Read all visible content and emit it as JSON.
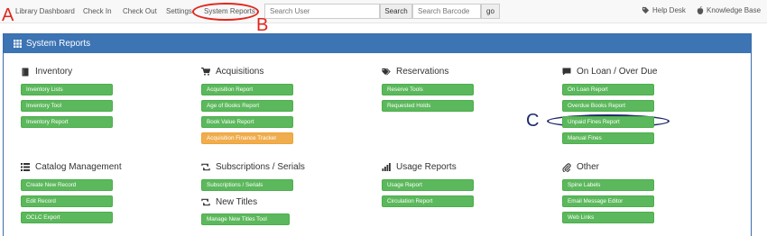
{
  "nav": {
    "items": [
      "Library Dashboard",
      "Check In",
      "Check Out",
      "Settings",
      "System Reports"
    ],
    "search_user_placeholder": "Search User",
    "search_button": "Search",
    "search_barcode_placeholder": "Search Barcode",
    "go_button": "go",
    "help_desk": "Help Desk",
    "knowledge_base": "Knowledge Base"
  },
  "annotations": {
    "a": "A",
    "b": "B",
    "c": "C"
  },
  "panel": {
    "title": "System Reports"
  },
  "sections": {
    "inventory": {
      "title": "Inventory",
      "buttons": [
        "Inventory Lists",
        "Inventory Tool",
        "Inventory Report"
      ]
    },
    "acquisitions": {
      "title": "Acquisitions",
      "buttons": [
        "Acquisition Report",
        "Age of Books Report",
        "Book Value Report",
        "Acquisition Finance Tracker"
      ]
    },
    "reservations": {
      "title": "Reservations",
      "buttons": [
        "Reserve Tools",
        "Requested Holds"
      ]
    },
    "on_loan": {
      "title": "On Loan / Over Due",
      "buttons": [
        "On Loan Report",
        "Overdue Books Report",
        "Unpaid Fines Report",
        "Manual Fines"
      ]
    },
    "catalog": {
      "title": "Catalog Management",
      "buttons": [
        "Create New Record",
        "Edit Record",
        "OCLC Export"
      ]
    },
    "subscriptions": {
      "title": "Subscriptions / Serials",
      "buttons": [
        "Subscriptions / Serials"
      ]
    },
    "new_titles": {
      "title": "New Titles",
      "buttons": [
        "Manage New Titles Tool"
      ]
    },
    "usage": {
      "title": "Usage Reports",
      "buttons": [
        "Usage Report",
        "Circulation Report"
      ]
    },
    "other": {
      "title": "Other",
      "buttons": [
        "Spine Labels",
        "Email Message Editor",
        "Web Links"
      ]
    }
  },
  "colors": {
    "header_blue": "#3c74b4",
    "button_green": "#5cb85c",
    "button_orange": "#f0ad4e",
    "annotation_red": "#e2261f",
    "annotation_navy": "#1f2a6b"
  }
}
